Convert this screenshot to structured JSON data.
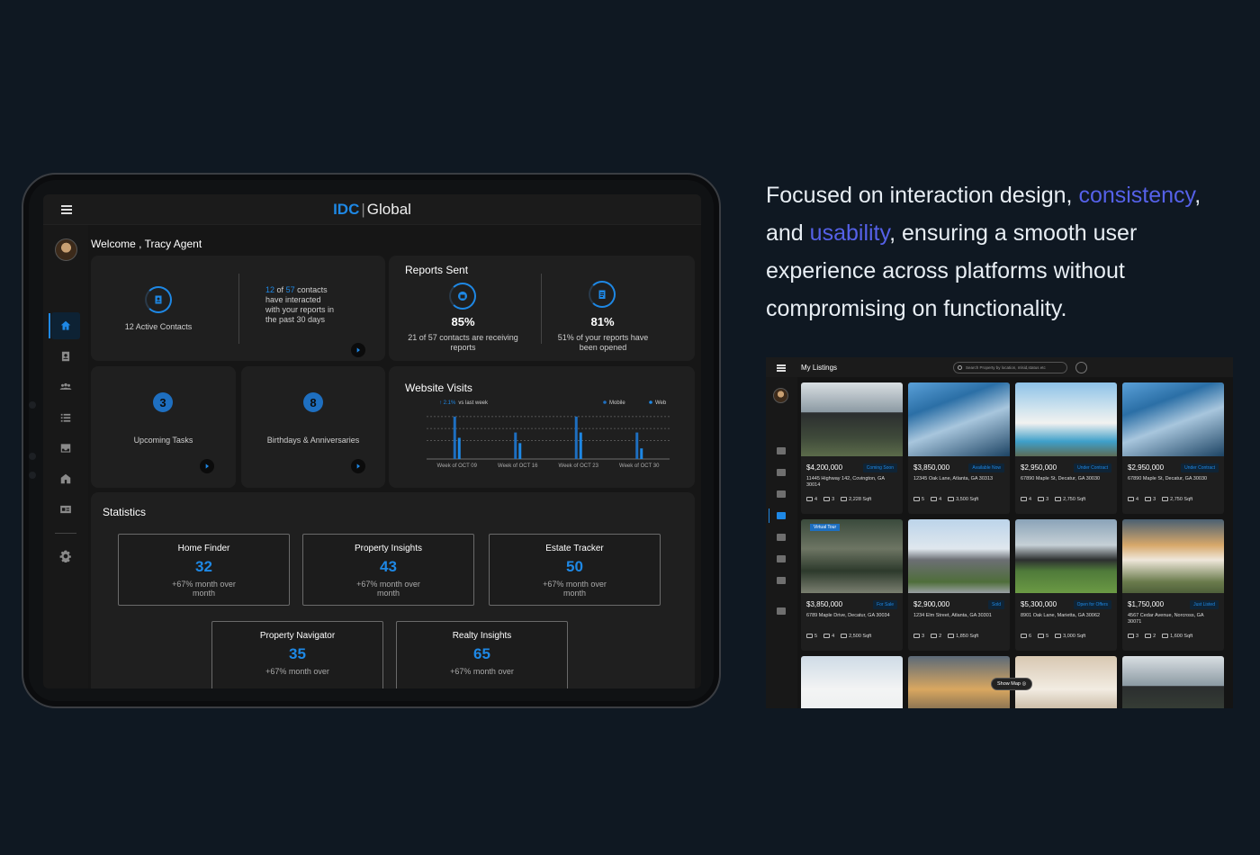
{
  "tablet": {
    "brand_left": "IDC",
    "brand_sep": "|",
    "brand_right": "Global",
    "welcome": "Welcome , Tracy Agent",
    "sidebar_icons": [
      "home-icon",
      "contacts-icon",
      "groups-icon",
      "list-icon",
      "inbox-icon",
      "house-icon",
      "id-card-icon",
      "gear-icon"
    ],
    "contacts_card": {
      "label": "12 Active Contacts",
      "interacted_a": "12",
      "interacted_of": "of",
      "interacted_b": "57",
      "interacted_tail1": "contacts",
      "interacted_tail2": "have interacted",
      "interacted_tail3": "with your reports in",
      "interacted_tail4": "the past 30 days"
    },
    "reports_card": {
      "title": "Reports Sent",
      "left_value": "85%",
      "left_desc": "21 of 57 contacts are receiving reports",
      "right_value": "81%",
      "right_desc": "51% of your reports have been opened"
    },
    "tasks_card": {
      "count": "3",
      "label": "Upcoming Tasks"
    },
    "birthdays_card": {
      "count": "8",
      "label": "Birthdays & Anniversaries"
    },
    "visits_card": {
      "title": "Website Visits",
      "change": "↑ 2.1%",
      "change_suffix": "vs last week",
      "legend_mobile": "Mobile",
      "legend_web": "Web"
    },
    "statistics": {
      "title": "Statistics",
      "items": [
        {
          "name": "Home Finder",
          "value": "32",
          "desc": "+67% month over month"
        },
        {
          "name": "Property Insights",
          "value": "43",
          "desc": "+67% month over month"
        },
        {
          "name": "Estate Tracker",
          "value": "50",
          "desc": "+67% month over month"
        },
        {
          "name": "Property Navigator",
          "value": "35",
          "desc": "+67% month over"
        },
        {
          "name": "Realty Insights",
          "value": "65",
          "desc": "+67% month over"
        }
      ]
    }
  },
  "chart_data": {
    "type": "bar",
    "title": "Website Visits",
    "categories": [
      "Week of OCT 09",
      "Week of OCT 16",
      "Week of OCT 23",
      "Week of OCT 30"
    ],
    "series": [
      {
        "name": "Mobile",
        "values": [
          8,
          5,
          8,
          5
        ]
      },
      {
        "name": "Web",
        "values": [
          4,
          3,
          5,
          2
        ]
      }
    ],
    "ylim": [
      0,
      9
    ],
    "grid": true,
    "legend": "top-right",
    "colors": {
      "Mobile": "#1e6fc0",
      "Web": "#1e88e5"
    }
  },
  "copy": {
    "p1": "Focused on interaction design, ",
    "hl1": "consistency",
    "p2": ", and ",
    "hl2": "usability",
    "p3": ", ensuring a smooth user experience across platforms without compromising on functionality."
  },
  "listings": {
    "title": "My Listings",
    "search_placeholder": "Search Property by location, mlsid,status etc",
    "show_map": "Show Map",
    "virtual_tour": "Virtual Tour",
    "cards": [
      {
        "price": "$4,200,000",
        "tag": "Coming Soon",
        "address": "11445 Highway 142, Covington, GA 30014",
        "beds": "4",
        "baths": "3",
        "sqft": "2,228 Sqft"
      },
      {
        "price": "$3,850,000",
        "tag": "Available Now",
        "address": "12345 Oak Lane, Atlanta, GA 30313",
        "beds": "5",
        "baths": "4",
        "sqft": "3,500 Sqft"
      },
      {
        "price": "$2,950,000",
        "tag": "Under Contract",
        "address": "67890 Maple St, Decatur, GA 30030",
        "beds": "4",
        "baths": "3",
        "sqft": "2,750 Sqft"
      },
      {
        "price": "$2,950,000",
        "tag": "Under Contract",
        "address": "67890 Maple St, Decatur, GA 30030",
        "beds": "4",
        "baths": "3",
        "sqft": "2,750 Sqft"
      },
      {
        "price": "$3,850,000",
        "tag": "For Sale",
        "address": "6789 Maple Drive, Decatur, GA 30034",
        "beds": "5",
        "baths": "4",
        "sqft": "2,500 Sqft"
      },
      {
        "price": "$2,900,000",
        "tag": "Sold",
        "address": "1234 Elm Street, Atlanta, GA 30301",
        "beds": "3",
        "baths": "2",
        "sqft": "1,850 Sqft"
      },
      {
        "price": "$5,300,000",
        "tag": "Open for Offers",
        "address": "8901 Oak Lane, Marietta, GA 30062",
        "beds": "6",
        "baths": "5",
        "sqft": "3,000 Sqft"
      },
      {
        "price": "$1,750,000",
        "tag": "Just Listed",
        "address": "4567 Cedar Avenue, Norcross, GA 30071",
        "beds": "3",
        "baths": "2",
        "sqft": "1,600 Sqft"
      }
    ]
  }
}
